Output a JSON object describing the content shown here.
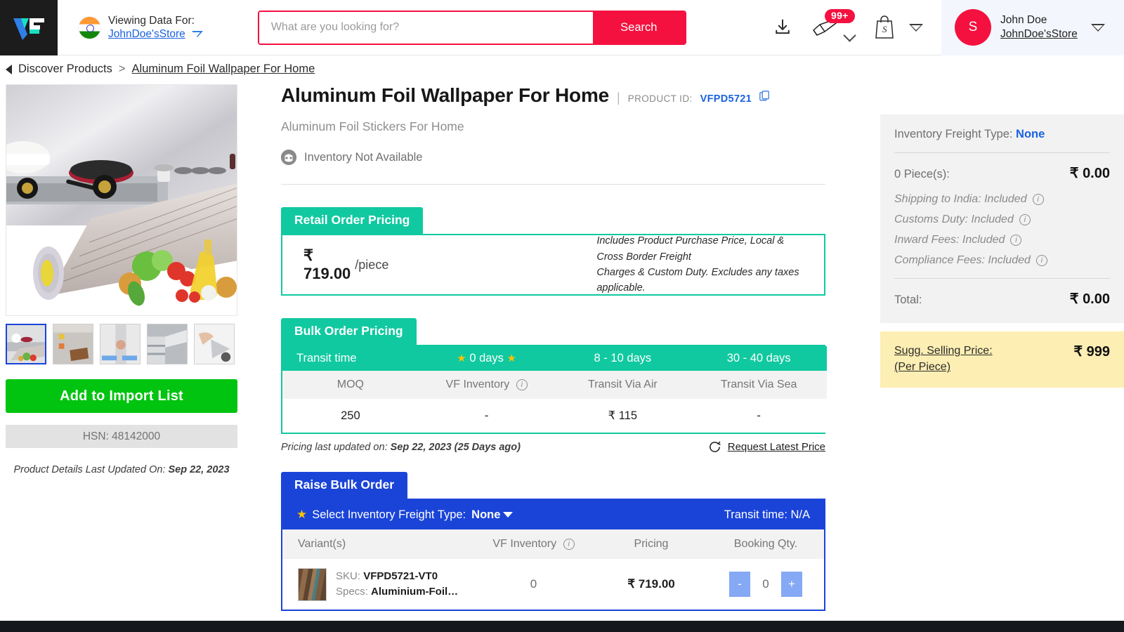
{
  "header": {
    "logo_alt": "VF",
    "viewing_label": "Viewing Data For:",
    "viewing_store": "JohnDoe'sStore",
    "search": {
      "placeholder": "What are you looking for?",
      "value": "",
      "button_label": "Search"
    },
    "notifications_badge": "99+",
    "user": {
      "initial": "S",
      "name": "John Doe",
      "store": "JohnDoe'sStore"
    }
  },
  "breadcrumb": {
    "back_label": "Discover Products",
    "separator": ">",
    "current": "Aluminum Foil Wallpaper For Home"
  },
  "gallery": {
    "thumb_count": 5,
    "selected_index": 0
  },
  "left": {
    "import_button": "Add to Import List",
    "hsn": "HSN: 48142000",
    "last_updated_label": "Product Details Last Updated On:",
    "last_updated_value": "Sep 22, 2023"
  },
  "product": {
    "title": "Aluminum Foil Wallpaper For Home",
    "pipe": "|",
    "product_id_label": "PRODUCT ID:",
    "product_id": "VFPD5721",
    "subtitle": "Aluminum Foil Stickers For Home",
    "inventory_status": "Inventory Not Available"
  },
  "retail": {
    "tab_label": "Retail Order Pricing",
    "price": "₹ 719.00",
    "unit": "/piece",
    "note_line1": "Includes Product Purchase Price, Local & Cross Border Freight",
    "note_line2": "Charges & Custom Duty. Excludes any taxes applicable."
  },
  "bulk": {
    "tab_label": "Bulk Order Pricing",
    "head": [
      "Transit time",
      "0 days",
      "8 - 10 days",
      "30 - 40 days"
    ],
    "subhead": [
      "MOQ",
      "VF Inventory",
      "Transit Via Air",
      "Transit Via Sea"
    ],
    "row": [
      "250",
      "-",
      "₹ 115",
      "-"
    ],
    "last_updated_label": "Pricing last updated on:",
    "last_updated_value": "Sep 22, 2023 (25 Days ago)",
    "request_latest": "Request Latest Price"
  },
  "raise_bulk": {
    "tab_label": "Raise Bulk Order",
    "freight_label": "Select Inventory Freight Type:",
    "freight_value": "None",
    "transit_time": "Transit time: N/A",
    "columns": [
      "Variant(s)",
      "VF Inventory",
      "Pricing",
      "Booking Qty."
    ],
    "rows": [
      {
        "sku_label": "SKU:",
        "sku": "VFPD5721-VT0",
        "specs_label": "Specs:",
        "specs": "Aluminium-Foil…",
        "vf_inventory": "0",
        "pricing": "₹ 719.00",
        "qty": "0",
        "minus": "-",
        "plus": "+"
      }
    ]
  },
  "summary": {
    "freight_type_label": "Inventory Freight Type:",
    "freight_type_value": "None",
    "pieces_label": "0 Piece(s):",
    "pieces_value": "₹ 0.00",
    "fees": [
      "Shipping to India: Included",
      "Customs Duty: Included",
      "Inward Fees: Included",
      "Compliance Fees: Included"
    ],
    "total_label": "Total:",
    "total_value": "₹ 0.00",
    "ssp_label_line1": "Sugg. Selling Price:",
    "ssp_label_line2": "(Per Piece)",
    "ssp_value": "₹ 999"
  },
  "colors": {
    "brand_red": "#f5113f",
    "teal": "#10c9a0",
    "blue": "#1a44d8",
    "green": "#00c40f",
    "link_blue": "#1a62e0",
    "yellow_panel": "#fdeeb3",
    "star_yellow": "#fcc201"
  }
}
